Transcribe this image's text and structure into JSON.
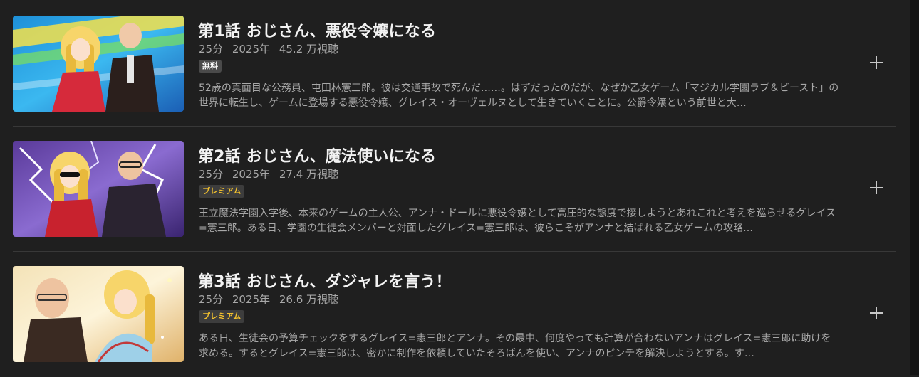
{
  "episodes": [
    {
      "title": "第1話 おじさん、悪役令嬢になる",
      "duration": "25分",
      "year": "2025年",
      "views": "45.2 万視聴",
      "badge": "無料",
      "badge_type": "free",
      "description": "52歳の真面目な公務員、屯田林憲三郎。彼は交通事故で死んだ……。はずだったのだが、なぜか乙女ゲーム「マジカル学園ラブ＆ビースト」の世界に転生し、ゲームに登場する悪役令嬢、グレイス・オーヴェルヌとして生きていくことに。公爵令嬢という前世と大…"
    },
    {
      "title": "第2話 おじさん、魔法使いになる",
      "duration": "25分",
      "year": "2025年",
      "views": "27.4 万視聴",
      "badge": "プレミアム",
      "badge_type": "premium",
      "description": "王立魔法学園入学後、本来のゲームの主人公、アンナ・ドールに悪役令嬢として高圧的な態度で接しようとあれこれと考えを巡らせるグレイス=憲三郎。ある日、学園の生徒会メンバーと対面したグレイス=憲三郎は、彼らこそがアンナと結ばれる乙女ゲームの攻略…"
    },
    {
      "title": "第3話 おじさん、ダジャレを言う！",
      "duration": "25分",
      "year": "2025年",
      "views": "26.6 万視聴",
      "badge": "プレミアム",
      "badge_type": "premium",
      "description": "ある日、生徒会の予算チェックをするグレイス=憲三郎とアンナ。その最中、何度やっても計算が合わないアンナはグレイス=憲三郎に助けを求める。するとグレイス=憲三郎は、密かに制作を依頼していたそろばんを使い、アンナのピンチを解決しようとする。す…"
    }
  ],
  "icons": {
    "add": "plus-icon"
  },
  "colors": {
    "background": "#1f1f1f",
    "premium": "#f2c12e",
    "free_badge": "#4a4a4a"
  }
}
